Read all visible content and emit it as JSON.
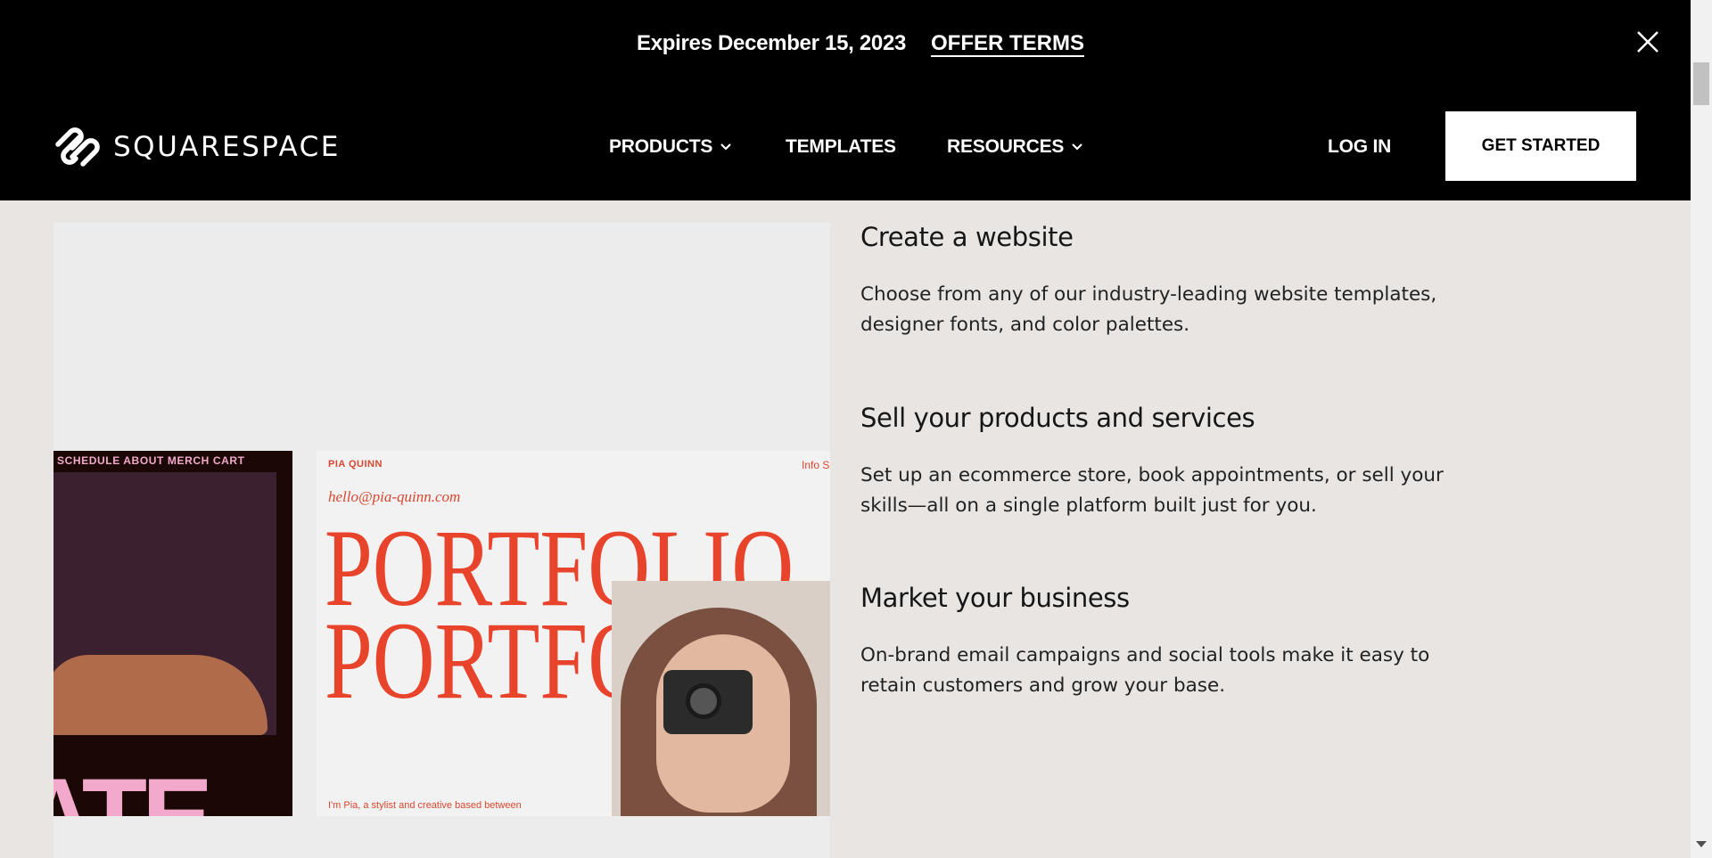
{
  "promo": {
    "expires": "Expires December 15, 2023",
    "terms": "OFFER TERMS"
  },
  "nav": {
    "logo": "SQUARESPACE",
    "items": [
      {
        "label": "PRODUCTS",
        "has_dropdown": true
      },
      {
        "label": "TEMPLATES",
        "has_dropdown": false
      },
      {
        "label": "RESOURCES",
        "has_dropdown": true
      }
    ],
    "login": "LOG IN",
    "cta": "GET STARTED"
  },
  "media": {
    "tile1_menu": "SCHEDULE  ABOUT  MERCH  CART",
    "tile1_big": "ATE",
    "tile2_name": "PIA QUINN",
    "tile2_info": "Info  S",
    "tile2_email": "hello@pia-quinn.com",
    "tile2_headline_1": "PORTFOLIO",
    "tile2_headline_2": "PORTFOLIO",
    "tile2_caption": "I'm Pia, a stylist and creative based between"
  },
  "features": [
    {
      "title": "Create a website",
      "body_line1": "Choose from any of our industry-leading website templates,",
      "body_line2": "designer fonts, and color palettes."
    },
    {
      "title": "Sell your products and services",
      "body_line1": "Set up an ecommerce store, book appointments, or sell your",
      "body_line2": "skills—all on a single platform built just for you."
    },
    {
      "title": "Market your business",
      "body_line1": "On-brand email campaigns and social tools make it easy to",
      "body_line2": "retain customers and grow your base."
    }
  ],
  "colors": {
    "nav_bg": "#000000",
    "page_bg": "#e8e5e3",
    "accent_red": "#e8432b",
    "accent_pink": "#f2a9cb"
  }
}
